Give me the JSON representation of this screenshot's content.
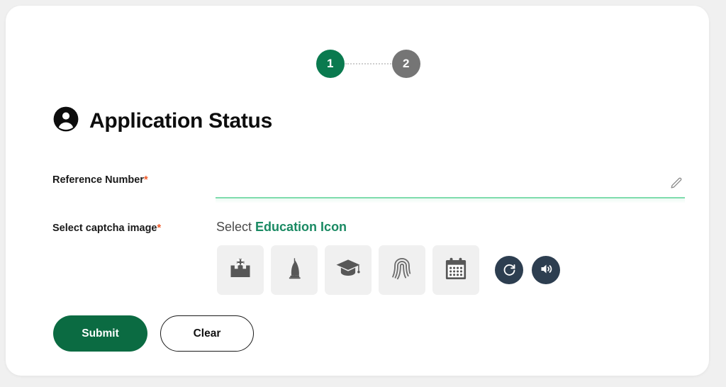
{
  "stepper": {
    "steps": [
      {
        "label": "1",
        "state": "active"
      },
      {
        "label": "2",
        "state": "inactive"
      }
    ],
    "active_color": "#0a7a4f",
    "inactive_color": "#757575"
  },
  "header": {
    "title": "Application Status",
    "icon": "person-circle-icon"
  },
  "form": {
    "reference_number": {
      "label": "Reference Number",
      "required_marker": "*",
      "value": "",
      "placeholder": "",
      "edit_icon": "pencil-icon",
      "underline_color": "#7fdcad"
    },
    "captcha": {
      "label": "Select captcha image",
      "required_marker": "*",
      "prompt_prefix": "Select",
      "prompt_target": "Education Icon",
      "target_color": "#1a8a63",
      "tiles": [
        {
          "icon": "hospital-icon",
          "name": "hospital"
        },
        {
          "icon": "burj-al-arab-icon",
          "name": "burj-al-arab"
        },
        {
          "icon": "graduation-cap-icon",
          "name": "graduation-cap"
        },
        {
          "icon": "fingerprint-icon",
          "name": "fingerprint"
        },
        {
          "icon": "calendar-icon",
          "name": "calendar"
        }
      ],
      "refresh_icon": "refresh-icon",
      "audio_icon": "speaker-icon",
      "button_color": "#2d3e50"
    }
  },
  "actions": {
    "submit_label": "Submit",
    "clear_label": "Clear",
    "submit_color": "#0b6b42"
  }
}
